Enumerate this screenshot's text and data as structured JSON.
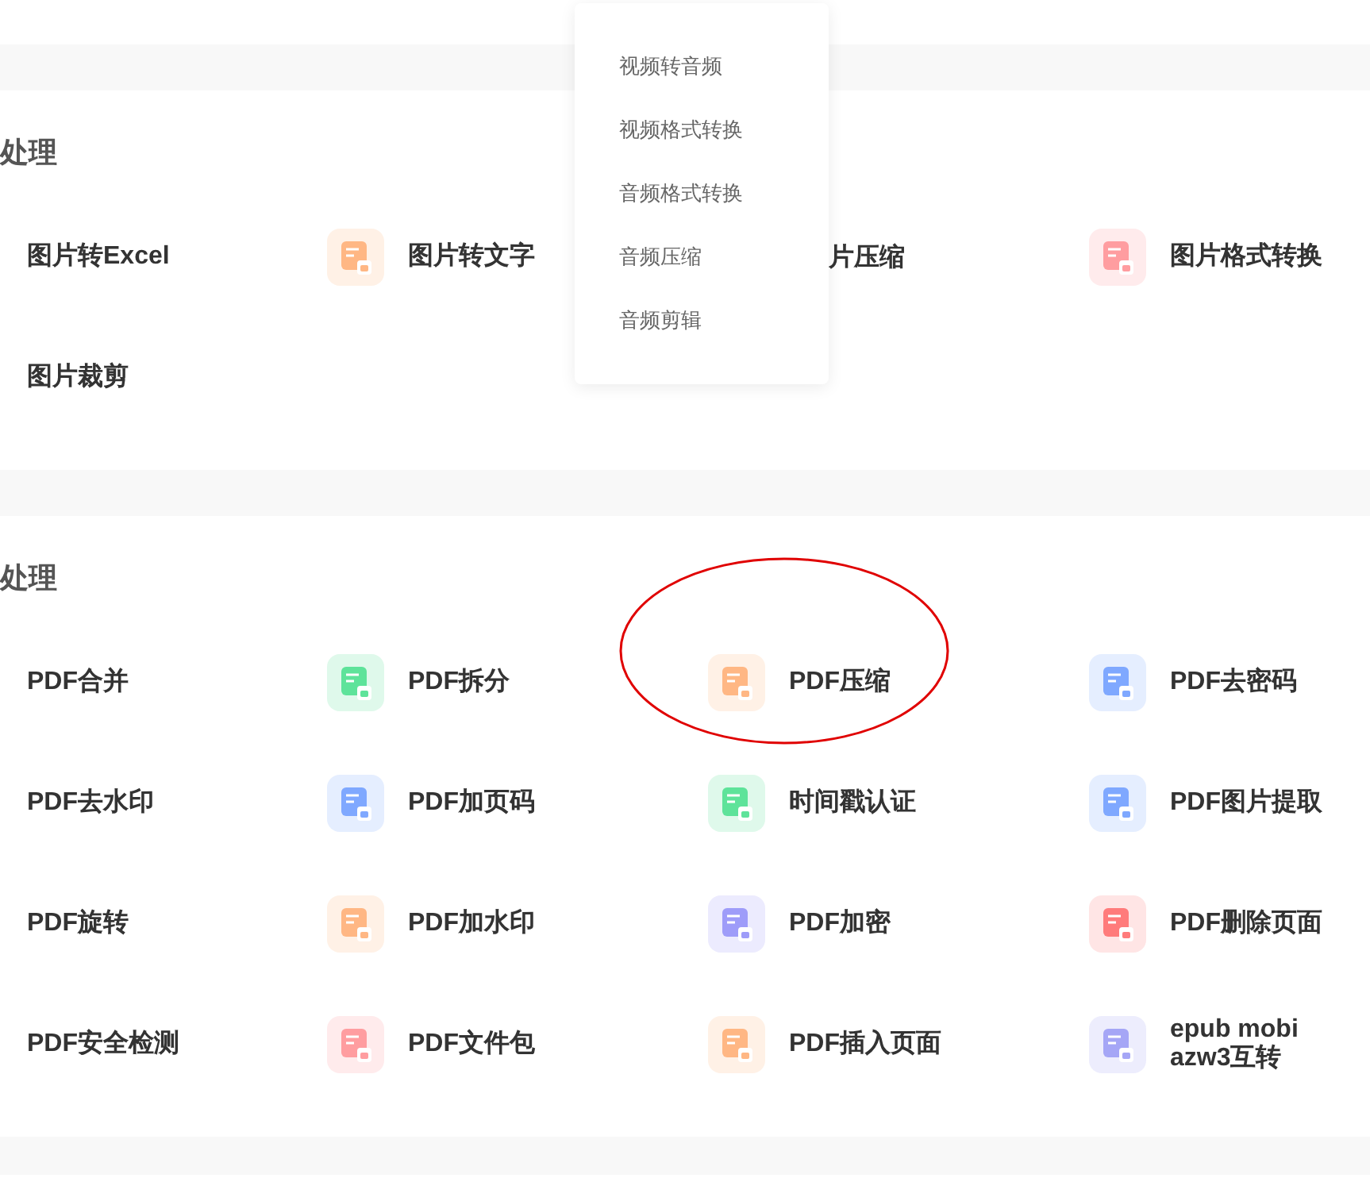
{
  "sections": [
    {
      "title": "处理",
      "items": [
        {
          "kind": "tool",
          "label": "图片转Excel"
        },
        {
          "kind": "tool",
          "label": "图片转文字",
          "color": "#ffb784"
        },
        {
          "kind": "clipped",
          "label": "片压缩"
        },
        {
          "kind": "tool",
          "label": "图片格式转换",
          "color": "#ff9da0"
        },
        {
          "kind": "tool",
          "label": "图片裁剪"
        }
      ]
    },
    {
      "title": "处理",
      "items": [
        {
          "kind": "tool",
          "label": "PDF合并"
        },
        {
          "kind": "tool",
          "label": "PDF拆分",
          "color": "#5ee39a"
        },
        {
          "kind": "tool",
          "label": "PDF压缩",
          "color": "#ffb784"
        },
        {
          "kind": "tool",
          "label": "PDF去密码",
          "color": "#7fa8ff"
        },
        {
          "kind": "tool",
          "label": "PDF去水印"
        },
        {
          "kind": "tool",
          "label": "PDF加页码",
          "color": "#7fa8ff"
        },
        {
          "kind": "tool",
          "label": "时间戳认证",
          "color": "#5ee39a"
        },
        {
          "kind": "tool",
          "label": "PDF图片提取",
          "color": "#7fa8ff"
        },
        {
          "kind": "tool",
          "label": "PDF旋转"
        },
        {
          "kind": "tool",
          "label": "PDF加水印",
          "color": "#ffb784"
        },
        {
          "kind": "tool",
          "label": "PDF加密",
          "color": "#9e9cf9"
        },
        {
          "kind": "tool",
          "label": "PDF删除页面",
          "color": "#ff7b7b"
        },
        {
          "kind": "tool",
          "label": "PDF安全检测"
        },
        {
          "kind": "tool",
          "label": "PDF文件包",
          "color": "#ff9da0"
        },
        {
          "kind": "tool",
          "label": "PDF插入页面",
          "color": "#ffb784"
        },
        {
          "kind": "tool",
          "label": "epub mobi\nazw3互转",
          "color": "#a5a6f6"
        }
      ]
    }
  ],
  "dropdown": {
    "items": [
      "视频转音频",
      "视频格式转换",
      "音频格式转换",
      "音频压缩",
      "音频剪辑"
    ]
  }
}
